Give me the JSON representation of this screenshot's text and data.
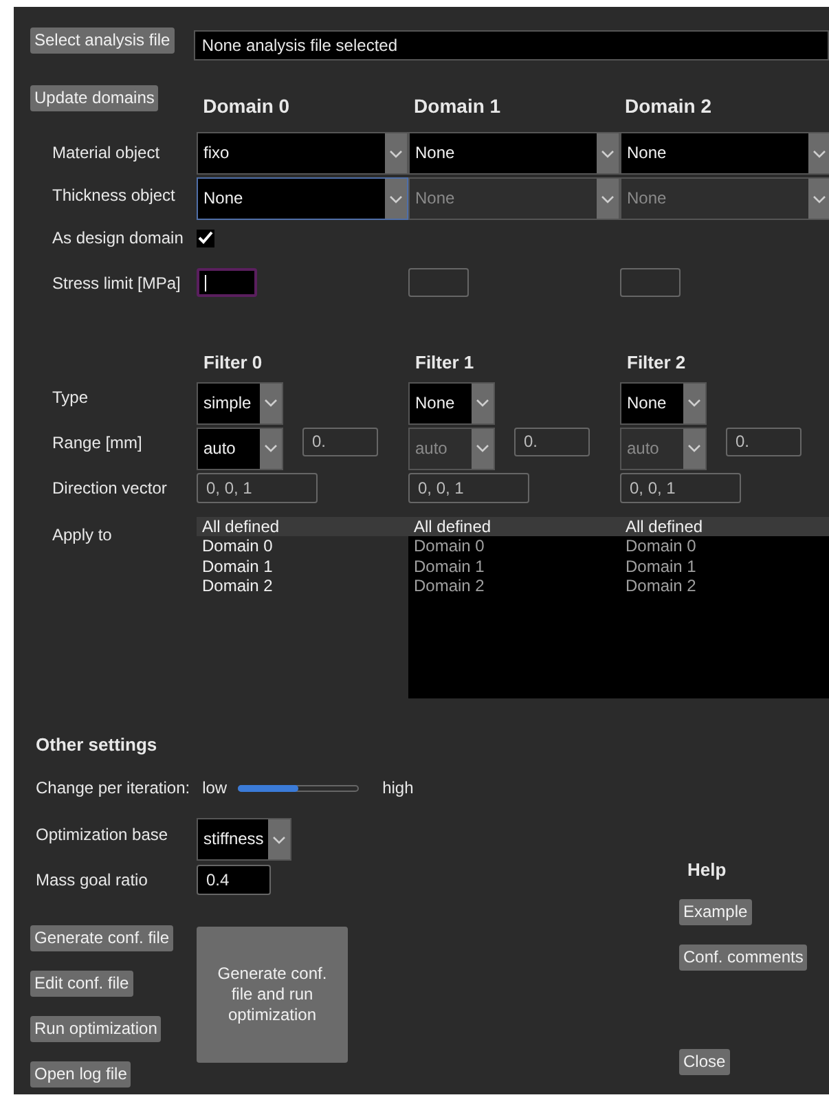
{
  "select_file": {
    "button": "Select analysis file",
    "field_value": "None analysis file selected"
  },
  "update_button": "Update domains",
  "domain_labels": [
    "Material object",
    "Thickness object",
    "As design domain",
    "Stress limit [MPa]"
  ],
  "domains": [
    {
      "title": "Domain 0",
      "material": {
        "value": "fixo",
        "disabled": false
      },
      "thickness": {
        "value": "None",
        "disabled": false,
        "focused": true
      },
      "as_design_domain": {
        "checked": true
      },
      "stress_limit": {
        "disabled": false,
        "editing": true
      }
    },
    {
      "title": "Domain 1",
      "material": {
        "value": "None",
        "disabled": false
      },
      "thickness": {
        "value": "None",
        "disabled": true,
        "focused": false
      },
      "stress_limit": {
        "disabled": true,
        "editing": false
      }
    },
    {
      "title": "Domain 2",
      "material": {
        "value": "None",
        "disabled": false
      },
      "thickness": {
        "value": "None",
        "disabled": true,
        "focused": false
      },
      "stress_limit": {
        "disabled": true,
        "editing": false
      }
    }
  ],
  "filter_labels": [
    "Type",
    "Range [mm]",
    "Direction vector",
    "Apply to"
  ],
  "filters": [
    {
      "title": "Filter 0",
      "type": "simple",
      "range": {
        "value": "auto",
        "disabled": false
      },
      "range_value": "0.",
      "direction": "0, 0, 1",
      "apply_to": {
        "disabled": false,
        "items": [
          {
            "label": "All defined",
            "selected": true
          },
          {
            "label": "Domain 0",
            "selected": false
          },
          {
            "label": "Domain 1",
            "selected": false
          },
          {
            "label": "Domain 2",
            "selected": false
          }
        ]
      }
    },
    {
      "title": "Filter 1",
      "type": "None",
      "range": {
        "value": "auto",
        "disabled": true
      },
      "range_value": "0.",
      "direction": "0, 0, 1",
      "apply_to": {
        "disabled": true,
        "items": [
          {
            "label": "All defined",
            "selected": true
          },
          {
            "label": "Domain 0",
            "selected": false
          },
          {
            "label": "Domain 1",
            "selected": false
          },
          {
            "label": "Domain 2",
            "selected": false
          }
        ]
      }
    },
    {
      "title": "Filter 2",
      "type": "None",
      "range": {
        "value": "auto",
        "disabled": true
      },
      "range_value": "0.",
      "direction": "0, 0, 1",
      "apply_to": {
        "disabled": true,
        "items": [
          {
            "label": "All defined",
            "selected": true
          },
          {
            "label": "Domain 0",
            "selected": false
          },
          {
            "label": "Domain 1",
            "selected": false
          },
          {
            "label": "Domain 2",
            "selected": false
          }
        ]
      }
    }
  ],
  "other_settings": {
    "title": "Other settings",
    "change_label": "Change per iteration:",
    "low": "low",
    "high": "high",
    "level": 0.5,
    "base_label": "Optimization base",
    "base_value": "stiffness",
    "mass_label": "Mass goal ratio",
    "mass_value": "0.4"
  },
  "action_buttons": [
    "Generate conf. file",
    "Edit conf. file",
    "Run optimization",
    "Open log file"
  ],
  "run_button": "Generate conf. file and run optimization",
  "help": {
    "title": "Help",
    "buttons": [
      "Example",
      "Conf. comments"
    ]
  },
  "close_button": "Close"
}
